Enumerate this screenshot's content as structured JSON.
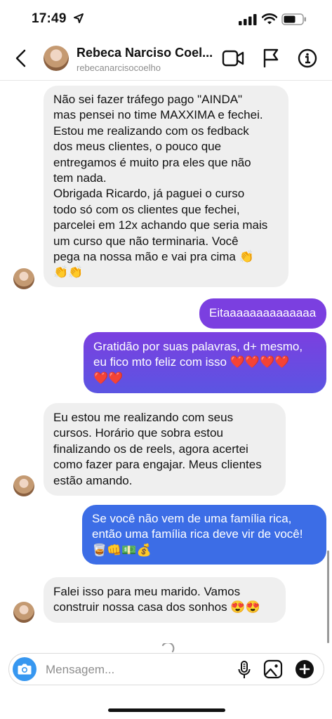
{
  "status_bar": {
    "time": "17:49"
  },
  "header": {
    "name": "Rebeca Narciso Coel...",
    "username": "rebecanarcisocoelho"
  },
  "messages": [
    {
      "direction": "received",
      "text": "Não sei fazer tráfego pago \"AINDA\"\nmas pensei no time MAXXIMA e fechei.\nEstou me realizando com os fedback\ndos meus clientes, o pouco que\nentregamos é muito pra eles que não\ntem nada.\nObrigada Ricardo, já paguei o curso\ntodo só com os clientes que fechei,\nparcelei em 12x achando que seria mais\num curso que não terminaria. Você\npega na nossa mão e vai pra cima 👏\n👏👏"
    },
    {
      "direction": "sent",
      "text": "Eitaaaaaaaaaaaaaa"
    },
    {
      "direction": "sent",
      "text": "Gratidão por suas palavras, d+ mesmo,\neu fico mto feliz com isso ❤️❤️❤️❤️\n❤️❤️"
    },
    {
      "direction": "received",
      "text": "Eu estou me realizando com seus\ncursos. Horário que sobra estou\nfinalizando os de reels, agora acertei\ncomo fazer para engajar. Meus clientes\nestão amando."
    },
    {
      "direction": "sent",
      "text": "Se você não vem de uma família rica,\nentão uma família rica deve vir de você!\n🥃👊💵💰"
    },
    {
      "direction": "received",
      "text": "Falei isso para meu marido. Vamos\nconstruir nossa casa dos sonhos 😍😍"
    }
  ],
  "composer": {
    "placeholder": "Mensagem..."
  },
  "colors": {
    "received_bubble": "#efefef",
    "sent_gradient_top": "#7b3fe0",
    "sent_gradient_bottom": "#3c6de6",
    "camera_button": "#3797f0"
  },
  "icons": [
    "location-arrow-icon",
    "signal-icon",
    "wifi-icon",
    "battery-icon",
    "back-chevron-icon",
    "video-call-icon",
    "flag-icon",
    "info-icon",
    "camera-icon",
    "microphone-icon",
    "gallery-icon",
    "plus-icon",
    "loading-spinner-icon"
  ]
}
